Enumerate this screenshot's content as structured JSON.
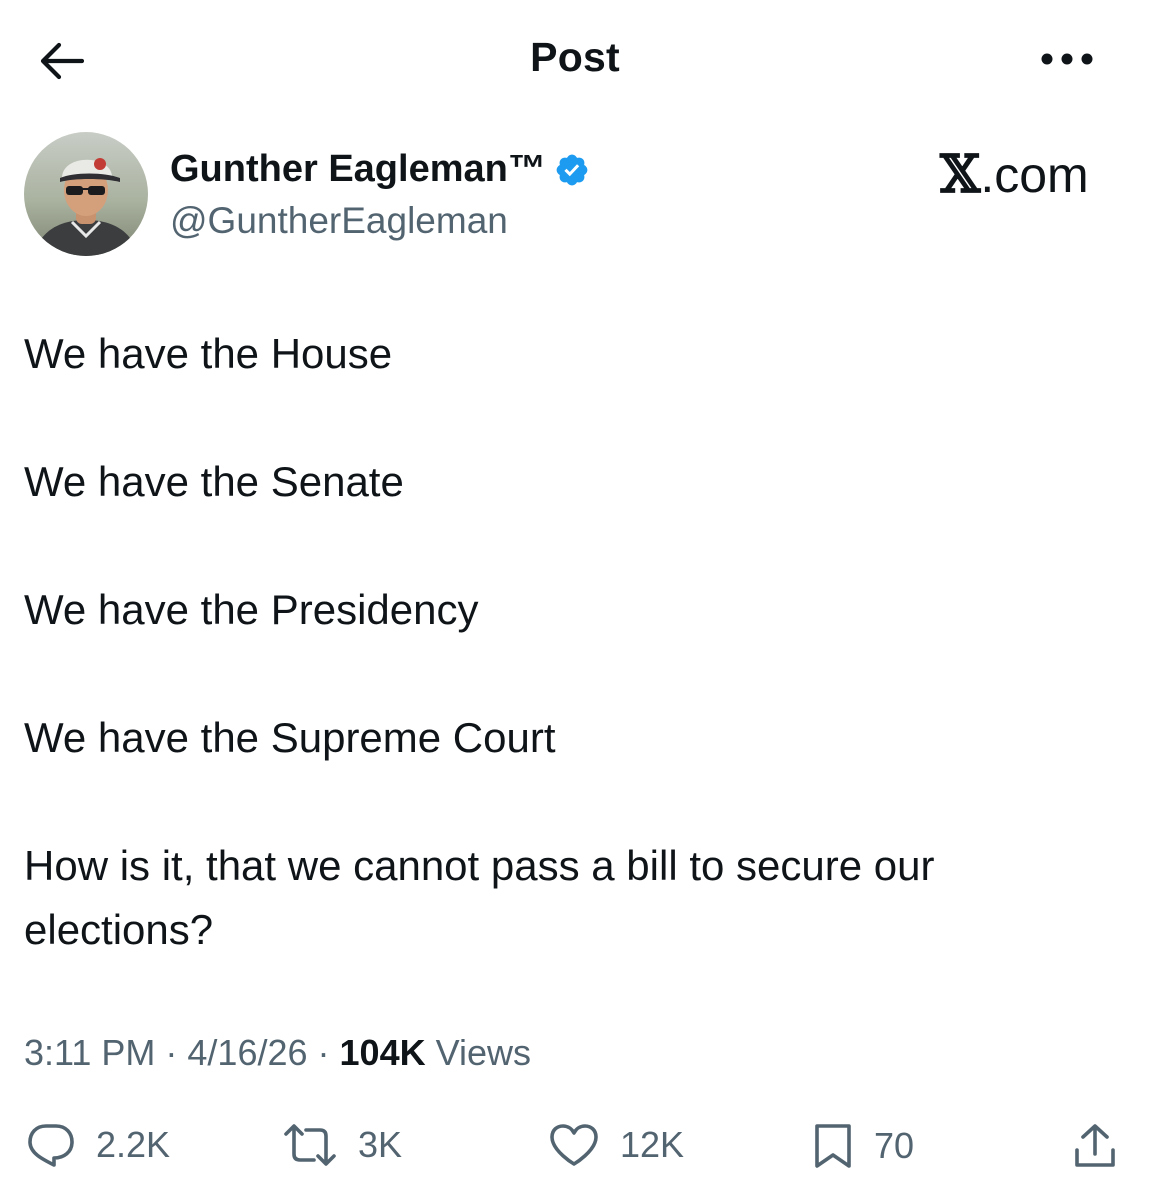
{
  "header": {
    "title": "Post",
    "back_icon": "arrow-left-icon",
    "more_icon": "more-horizontal-icon"
  },
  "author": {
    "display_name": "Gunther Eagleman™",
    "handle": "@GuntherEagleman",
    "verified": true,
    "verified_color": "#1d9bf0"
  },
  "watermark": {
    "logo_letter": "𝕏",
    "suffix": ".com"
  },
  "post": {
    "lines": [
      "We have the House",
      "We have the Senate",
      "We have the Presidency",
      "We have the Supreme Court",
      "How is it, that we cannot pass a bill to secure our elections?"
    ]
  },
  "meta": {
    "time": "3:11 PM",
    "sep1": " · ",
    "date": "4/16/26",
    "sep2": " · ",
    "views_count": "104K",
    "views_label": " Views"
  },
  "actions": {
    "replies": "2.2K",
    "reposts": "3K",
    "likes": "12K",
    "bookmarks": "70"
  },
  "colors": {
    "text": "#0f1419",
    "secondary": "#536471",
    "accent": "#1d9bf0"
  }
}
